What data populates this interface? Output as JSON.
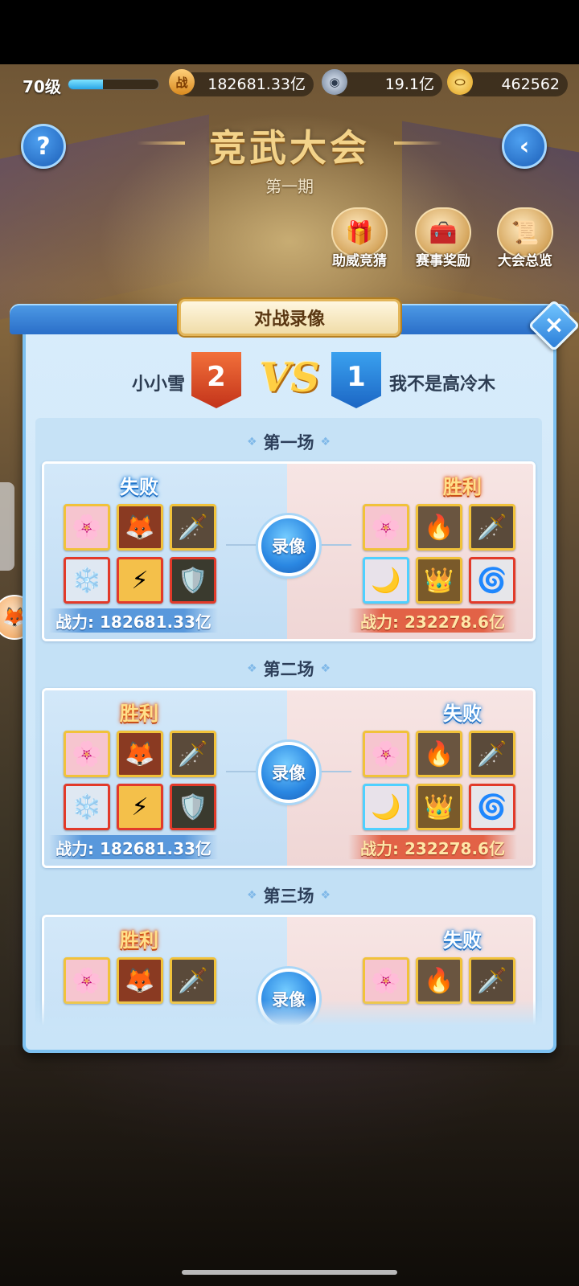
{
  "topbar": {
    "level": "70级",
    "xp_progress": 0.38,
    "combat_power": "182681.33亿",
    "combat_icon": "战",
    "coins": "19.1亿",
    "coin_icon": "coin-icon",
    "ingots": "462562",
    "ingot_icon": "ingot-icon"
  },
  "header": {
    "title": "竞武大会",
    "subtitle": "第一期",
    "help_icon": "?",
    "back_icon": "‹",
    "features": [
      {
        "label": "助威竞猜",
        "icon": "🎁"
      },
      {
        "label": "赛事奖励",
        "icon": "🧰"
      },
      {
        "label": "大会总览",
        "icon": "📜"
      }
    ]
  },
  "dialog": {
    "title": "对战录像",
    "close_icon": "×",
    "left_player": "小小雪",
    "left_score": "2",
    "right_player": "我不是高冷木",
    "right_score": "1",
    "vs": "VS",
    "replay_label": "录像",
    "matches": [
      {
        "title": "第一场",
        "left_result": "失败",
        "left_result_type": "lose",
        "right_result": "胜利",
        "right_result_type": "win",
        "left_power": "战力: 182681.33亿",
        "right_power": "战力: 232278.6亿",
        "left_heroes": [
          "🌸",
          "🦊",
          "🗡️",
          "❄️",
          "⚡",
          "🛡️"
        ],
        "right_heroes": [
          "🌸",
          "🔥",
          "🗡️",
          "🌙",
          "👑",
          "🌀"
        ]
      },
      {
        "title": "第二场",
        "left_result": "胜利",
        "left_result_type": "win",
        "right_result": "失败",
        "right_result_type": "lose",
        "left_power": "战力: 182681.33亿",
        "right_power": "战力: 232278.6亿",
        "left_heroes": [
          "🌸",
          "🦊",
          "🗡️",
          "❄️",
          "⚡",
          "🛡️"
        ],
        "right_heroes": [
          "🌸",
          "🔥",
          "🗡️",
          "🌙",
          "👑",
          "🌀"
        ]
      },
      {
        "title": "第三场",
        "left_result": "胜利",
        "left_result_type": "win",
        "right_result": "失败",
        "right_result_type": "lose",
        "left_heroes": [
          "🌸",
          "🦊",
          "🗡️"
        ],
        "right_heroes": [
          "🌸",
          "🔥",
          "🗡️"
        ]
      }
    ]
  },
  "colors": {
    "win_red": "#c3331a",
    "lose_blue": "#1c66c4",
    "gold": "#f1c23a",
    "panel_blue": "#c9e4f8"
  }
}
